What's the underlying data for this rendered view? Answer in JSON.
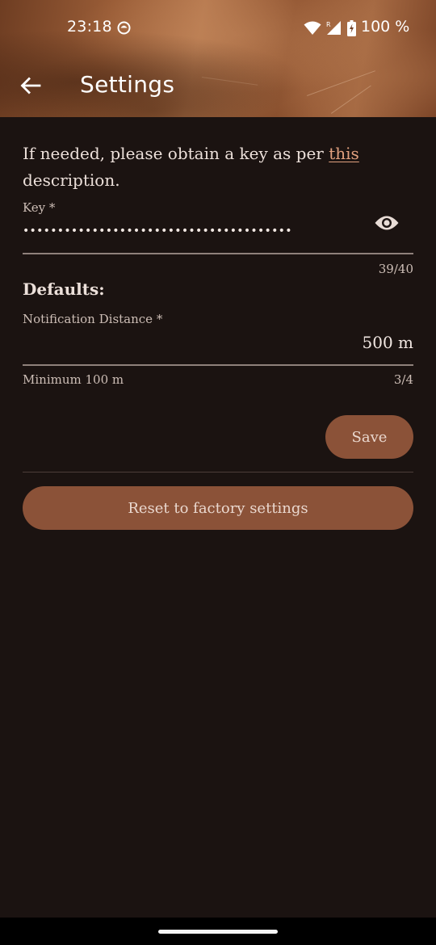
{
  "status_bar": {
    "time": "23:18",
    "battery": "100 %",
    "icons": [
      "app-notification-icon",
      "wifi-icon",
      "signal-roaming-icon",
      "battery-charging-icon"
    ]
  },
  "app_bar": {
    "back_icon": "arrow-back-icon",
    "title": "Settings"
  },
  "intro": {
    "text_before": "If needed, please obtain a key as per ",
    "link": "this",
    "text_after": " description."
  },
  "key_field": {
    "label": "Key *",
    "value_masked": "•••••••••••••••••••••••••••••••••••••••",
    "visibility_icon": "eye-icon",
    "counter": "39/40"
  },
  "defaults": {
    "title": "Defaults:",
    "distance_field": {
      "label": "Notification Distance *",
      "value": "500 m",
      "helper": "Minimum 100 m",
      "counter": "3/4"
    }
  },
  "buttons": {
    "save": "Save",
    "reset": "Reset to factory settings"
  },
  "colors": {
    "background": "#1b1311",
    "accent_button": "#8b5238",
    "link": "#e2a17f"
  }
}
